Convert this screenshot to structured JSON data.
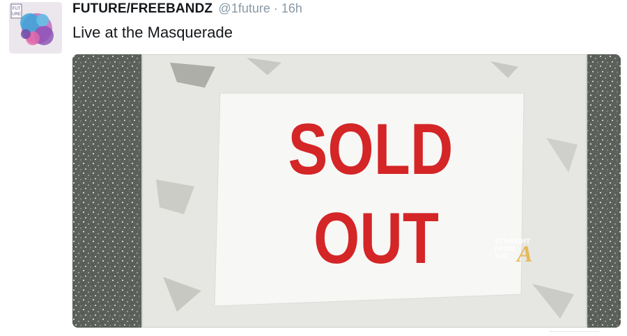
{
  "tweet": {
    "display_name": "FUTURE/FREEBANDZ",
    "handle": "@1future",
    "separator": " · ",
    "timestamp": "16h",
    "text": "Live at the Masquerade"
  },
  "avatar": {
    "cover_tag_top": "FUT",
    "cover_tag_bottom": "URE",
    "icon": "album-cover-icon"
  },
  "media": {
    "sign_line_1": "SOLD",
    "sign_line_2": "OUT",
    "watermark_line_1": "STRAIGHT",
    "watermark_line_2": "FROM",
    "watermark_line_3": "THE",
    "watermark_glyph": "A",
    "colors": {
      "sign_text": "#d42527",
      "paper": "#f7f7f5",
      "wall": "#e6e7e2",
      "granite": "#5a5f58",
      "watermark_accent": "#e8b54a"
    }
  }
}
